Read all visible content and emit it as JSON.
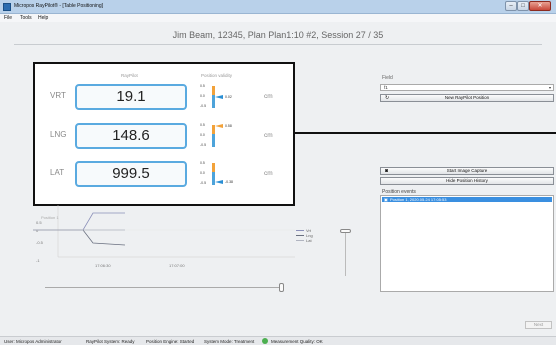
{
  "window": {
    "title": "Micropos RayPilot® - [Table Positioning]",
    "minimize": "–",
    "maximize": "□",
    "close": "✕"
  },
  "menu": [
    "File",
    "Tools",
    "Help"
  ],
  "session_header": "Jim Beam, 12345, Plan Plan1:10 #2, Session 27 / 35",
  "panel": {
    "col_raypilot": "RayPilot",
    "col_validity": "Position validity",
    "unit": "cm",
    "scale": [
      "0.5",
      "0.0",
      "-0.5"
    ],
    "rows": [
      {
        "axis": "VRT",
        "value": "19.1",
        "gauge_value": "0.02"
      },
      {
        "axis": "LNG",
        "value": "148.6",
        "gauge_value": "0.58"
      },
      {
        "axis": "LAT",
        "value": "999.5",
        "gauge_value": "-0.38"
      }
    ]
  },
  "chart": {
    "series_name": "Position 1",
    "y_ticks": [
      "0.5",
      "0",
      "-0.5",
      "-1"
    ],
    "x_ticks": [
      "17:06:30",
      "17:07:00"
    ],
    "legend": [
      "Vrt",
      "Lng",
      "Lat"
    ],
    "colors": {
      "Vrt": "#8a8fb8",
      "Lng": "#6a7080",
      "Lat": "#b0b4c0"
    }
  },
  "field": {
    "label": "Field",
    "value": "f1"
  },
  "buttons": {
    "new_position": "New RayPilot Position",
    "start_capture": "Start Image Capture",
    "hide_history": "Hide Position History",
    "next": "Next"
  },
  "events": {
    "label": "Position events",
    "items": [
      "Position 1, 2020.05.24 17:05:53"
    ]
  },
  "status": {
    "user": "User: Micropos Administrator",
    "system": "RayPilot System: Ready",
    "engine": "Position Engine: Started",
    "mode": "System Mode: Treatment",
    "quality": "Measurement Quality: OK"
  },
  "icon_names": [
    "app-icon",
    "refresh-icon",
    "camera-icon",
    "dropdown-arrow-icon",
    "event-icon",
    "check-ok-icon"
  ]
}
